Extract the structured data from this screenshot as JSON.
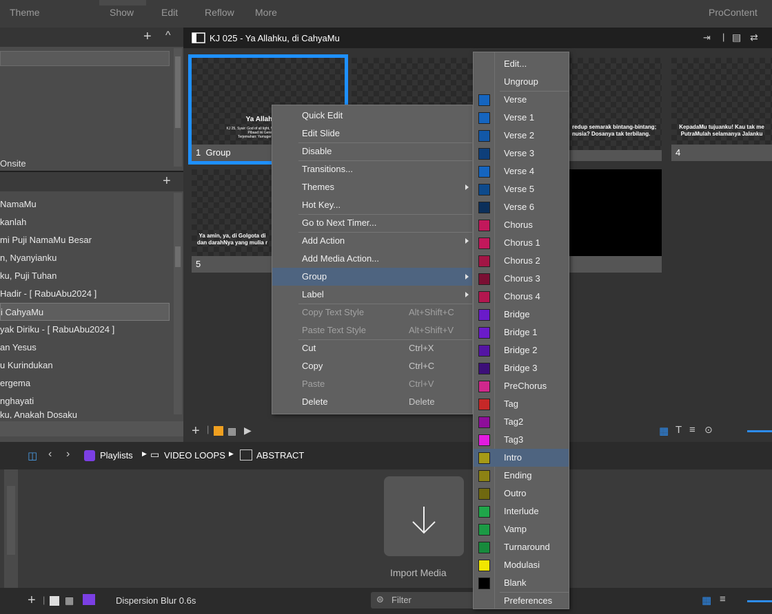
{
  "menubar": {
    "items": [
      "Theme",
      "Show",
      "Edit",
      "Reflow",
      "More"
    ],
    "right": "ProContent"
  },
  "library": {
    "onsite_label": "Onsite",
    "songs": [
      "NamaMu",
      "kanlah",
      "mi Puji NamaMu Besar",
      "n, Nyanyianku",
      "ku, Puji Tuhan",
      "Hadir - [ RabuAbu2024 ]",
      "i CahyaMu",
      "yak Diriku  - [ RabuAbu2024 ]",
      "an Yesus",
      "u Kurindukan",
      "ergema",
      "nghayati",
      "ku, Anakah Dosaku"
    ]
  },
  "document": {
    "title": "KJ 025 - Ya Allahku, di CahyaMu"
  },
  "slides": [
    {
      "number": "1",
      "label": "Group",
      "title": "Ya Allahku, di",
      "small": "KJ 25, Syair: God of all light, Wassenaar dan den Berg\nPibaad ini Gereel Scheline\nTerjemahan: Yamuger, 1984 Lagu: Arr..."
    },
    {
      "number": "",
      "label": "",
      "title": "redup semarak bintang-bintang;\nnusia? Dosanya tak terbilang."
    },
    {
      "number": "4",
      "label": "",
      "title": "KepadaMu tujuanku! Kau tak me\nPutraMulah selamanya Jalanku"
    },
    {
      "number": "5",
      "label": "",
      "title": "Ya amin, ya, di Golgota di\ndan darahNya yang mulia r"
    }
  ],
  "media": {
    "breadcrumb": [
      "Playlists",
      "VIDEO LOOPS",
      "ABSTRACT"
    ],
    "import_label": "Import Media",
    "transition": "Dispersion Blur 0.6s",
    "filter_placeholder": "Filter"
  },
  "context_menu": {
    "items": [
      {
        "label": "Quick Edit",
        "shortcut": "",
        "disabled": false,
        "submenu": false
      },
      {
        "label": "Edit Slide",
        "shortcut": "",
        "disabled": false,
        "submenu": false
      },
      {
        "label": "Disable",
        "shortcut": "",
        "disabled": false,
        "submenu": false
      },
      {
        "label": "Transitions...",
        "shortcut": "",
        "disabled": false,
        "submenu": false
      },
      {
        "label": "Themes",
        "shortcut": "",
        "disabled": false,
        "submenu": true
      },
      {
        "label": "Hot Key...",
        "shortcut": "",
        "disabled": false,
        "submenu": false
      },
      {
        "label": "Go to Next Timer...",
        "shortcut": "",
        "disabled": false,
        "submenu": false
      },
      {
        "label": "Add Action",
        "shortcut": "",
        "disabled": false,
        "submenu": true
      },
      {
        "label": "Add Media Action...",
        "shortcut": "",
        "disabled": false,
        "submenu": false
      },
      {
        "label": "Group",
        "shortcut": "",
        "disabled": false,
        "submenu": true,
        "highlight": true
      },
      {
        "label": "Label",
        "shortcut": "",
        "disabled": false,
        "submenu": true
      },
      {
        "label": "Copy Text Style",
        "shortcut": "Alt+Shift+C",
        "disabled": true,
        "submenu": false
      },
      {
        "label": "Paste Text Style",
        "shortcut": "Alt+Shift+V",
        "disabled": true,
        "submenu": false
      },
      {
        "label": "Cut",
        "shortcut": "Ctrl+X",
        "disabled": false,
        "submenu": false
      },
      {
        "label": "Copy",
        "shortcut": "Ctrl+C",
        "disabled": false,
        "submenu": false
      },
      {
        "label": "Paste",
        "shortcut": "Ctrl+V",
        "disabled": true,
        "submenu": false
      },
      {
        "label": "Delete",
        "shortcut": "Delete",
        "disabled": false,
        "submenu": false
      }
    ]
  },
  "group_menu": {
    "items": [
      {
        "label": "Edit...",
        "color": ""
      },
      {
        "label": "Ungroup",
        "color": ""
      },
      {
        "label": "Verse",
        "color": "#1565c0"
      },
      {
        "label": "Verse 1",
        "color": "#1565c0"
      },
      {
        "label": "Verse 2",
        "color": "#1258a8"
      },
      {
        "label": "Verse 3",
        "color": "#0e3f7a"
      },
      {
        "label": "Verse 4",
        "color": "#1565c0"
      },
      {
        "label": "Verse 5",
        "color": "#0d4a8c"
      },
      {
        "label": "Verse 6",
        "color": "#0b2f5a"
      },
      {
        "label": "Chorus",
        "color": "#c2185b"
      },
      {
        "label": "Chorus 1",
        "color": "#c2185b"
      },
      {
        "label": "Chorus 2",
        "color": "#a31545"
      },
      {
        "label": "Chorus 3",
        "color": "#7a0f33"
      },
      {
        "label": "Chorus 4",
        "color": "#b3164f"
      },
      {
        "label": "Bridge",
        "color": "#6a1bc9"
      },
      {
        "label": "Bridge 1",
        "color": "#6a1bc9"
      },
      {
        "label": "Bridge 2",
        "color": "#5415a3"
      },
      {
        "label": "Bridge 3",
        "color": "#3c0f78"
      },
      {
        "label": "PreChorus",
        "color": "#d0278c"
      },
      {
        "label": "Tag",
        "color": "#c62828"
      },
      {
        "label": "Tag2",
        "color": "#8e0e9a"
      },
      {
        "label": "Tag3",
        "color": "#e31ce0"
      },
      {
        "label": "Intro",
        "color": "#a69a16"
      },
      {
        "label": "Ending",
        "color": "#8c8214"
      },
      {
        "label": "Outro",
        "color": "#6f6810"
      },
      {
        "label": "Interlude",
        "color": "#1fa64a"
      },
      {
        "label": "Vamp",
        "color": "#1a9a44"
      },
      {
        "label": "Turnaround",
        "color": "#178a3c"
      },
      {
        "label": "Modulasi",
        "color": "#f2e600"
      },
      {
        "label": "Blank",
        "color": "#000000"
      },
      {
        "label": "Preferences",
        "color": ""
      }
    ]
  }
}
